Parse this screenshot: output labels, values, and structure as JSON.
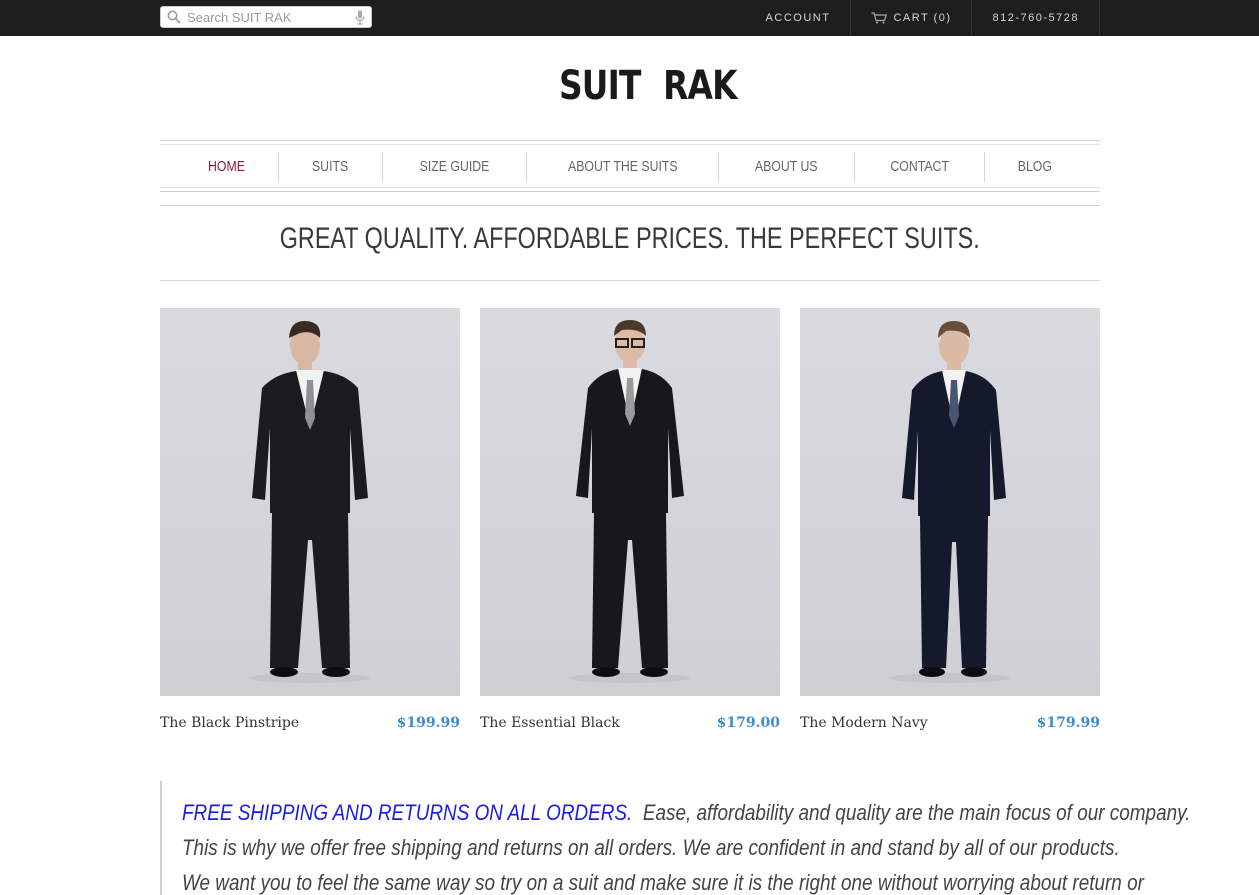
{
  "topbar": {
    "search_placeholder": "Search SUIT RAK",
    "account": "ACCOUNT",
    "cart": "CART (0)",
    "phone": "812-760-5728"
  },
  "logo": {
    "left": "SUIT",
    "right": "RAK"
  },
  "nav": {
    "items": [
      "HOME",
      "SUITS",
      "SIZE GUIDE",
      "ABOUT THE SUITS",
      "ABOUT US",
      "CONTACT",
      "BLOG"
    ],
    "active": "HOME",
    "active_color": "#8b1c3a"
  },
  "tagline": "GREAT QUALITY. AFFORDABLE PRICES. THE PERFECT SUITS.",
  "products": [
    {
      "name": "The Black Pinstripe",
      "price": "$199.99",
      "suit_color": "#1b1c22",
      "tie_color": "#8f9093"
    },
    {
      "name": "The Essential Black",
      "price": "$179.00",
      "suit_color": "#18181c",
      "tie_color": "#9a9a9c"
    },
    {
      "name": "The Modern Navy",
      "price": "$179.99",
      "suit_color": "#141a2b",
      "tie_color": "#4a5670"
    }
  ],
  "price_color": "#3a8ed0",
  "promo": {
    "highlight": "FREE SHIPPING AND RETURNS ON ALL ORDERS.",
    "line1_rest": "Ease, affordability and quality are the main focus of our company.",
    "line2": "This is why we offer free shipping and returns on all orders. We are confident in and stand by all of our products.",
    "line3": "We want you to feel the same way so try on a suit and make sure it is the right one without worrying about return or"
  }
}
